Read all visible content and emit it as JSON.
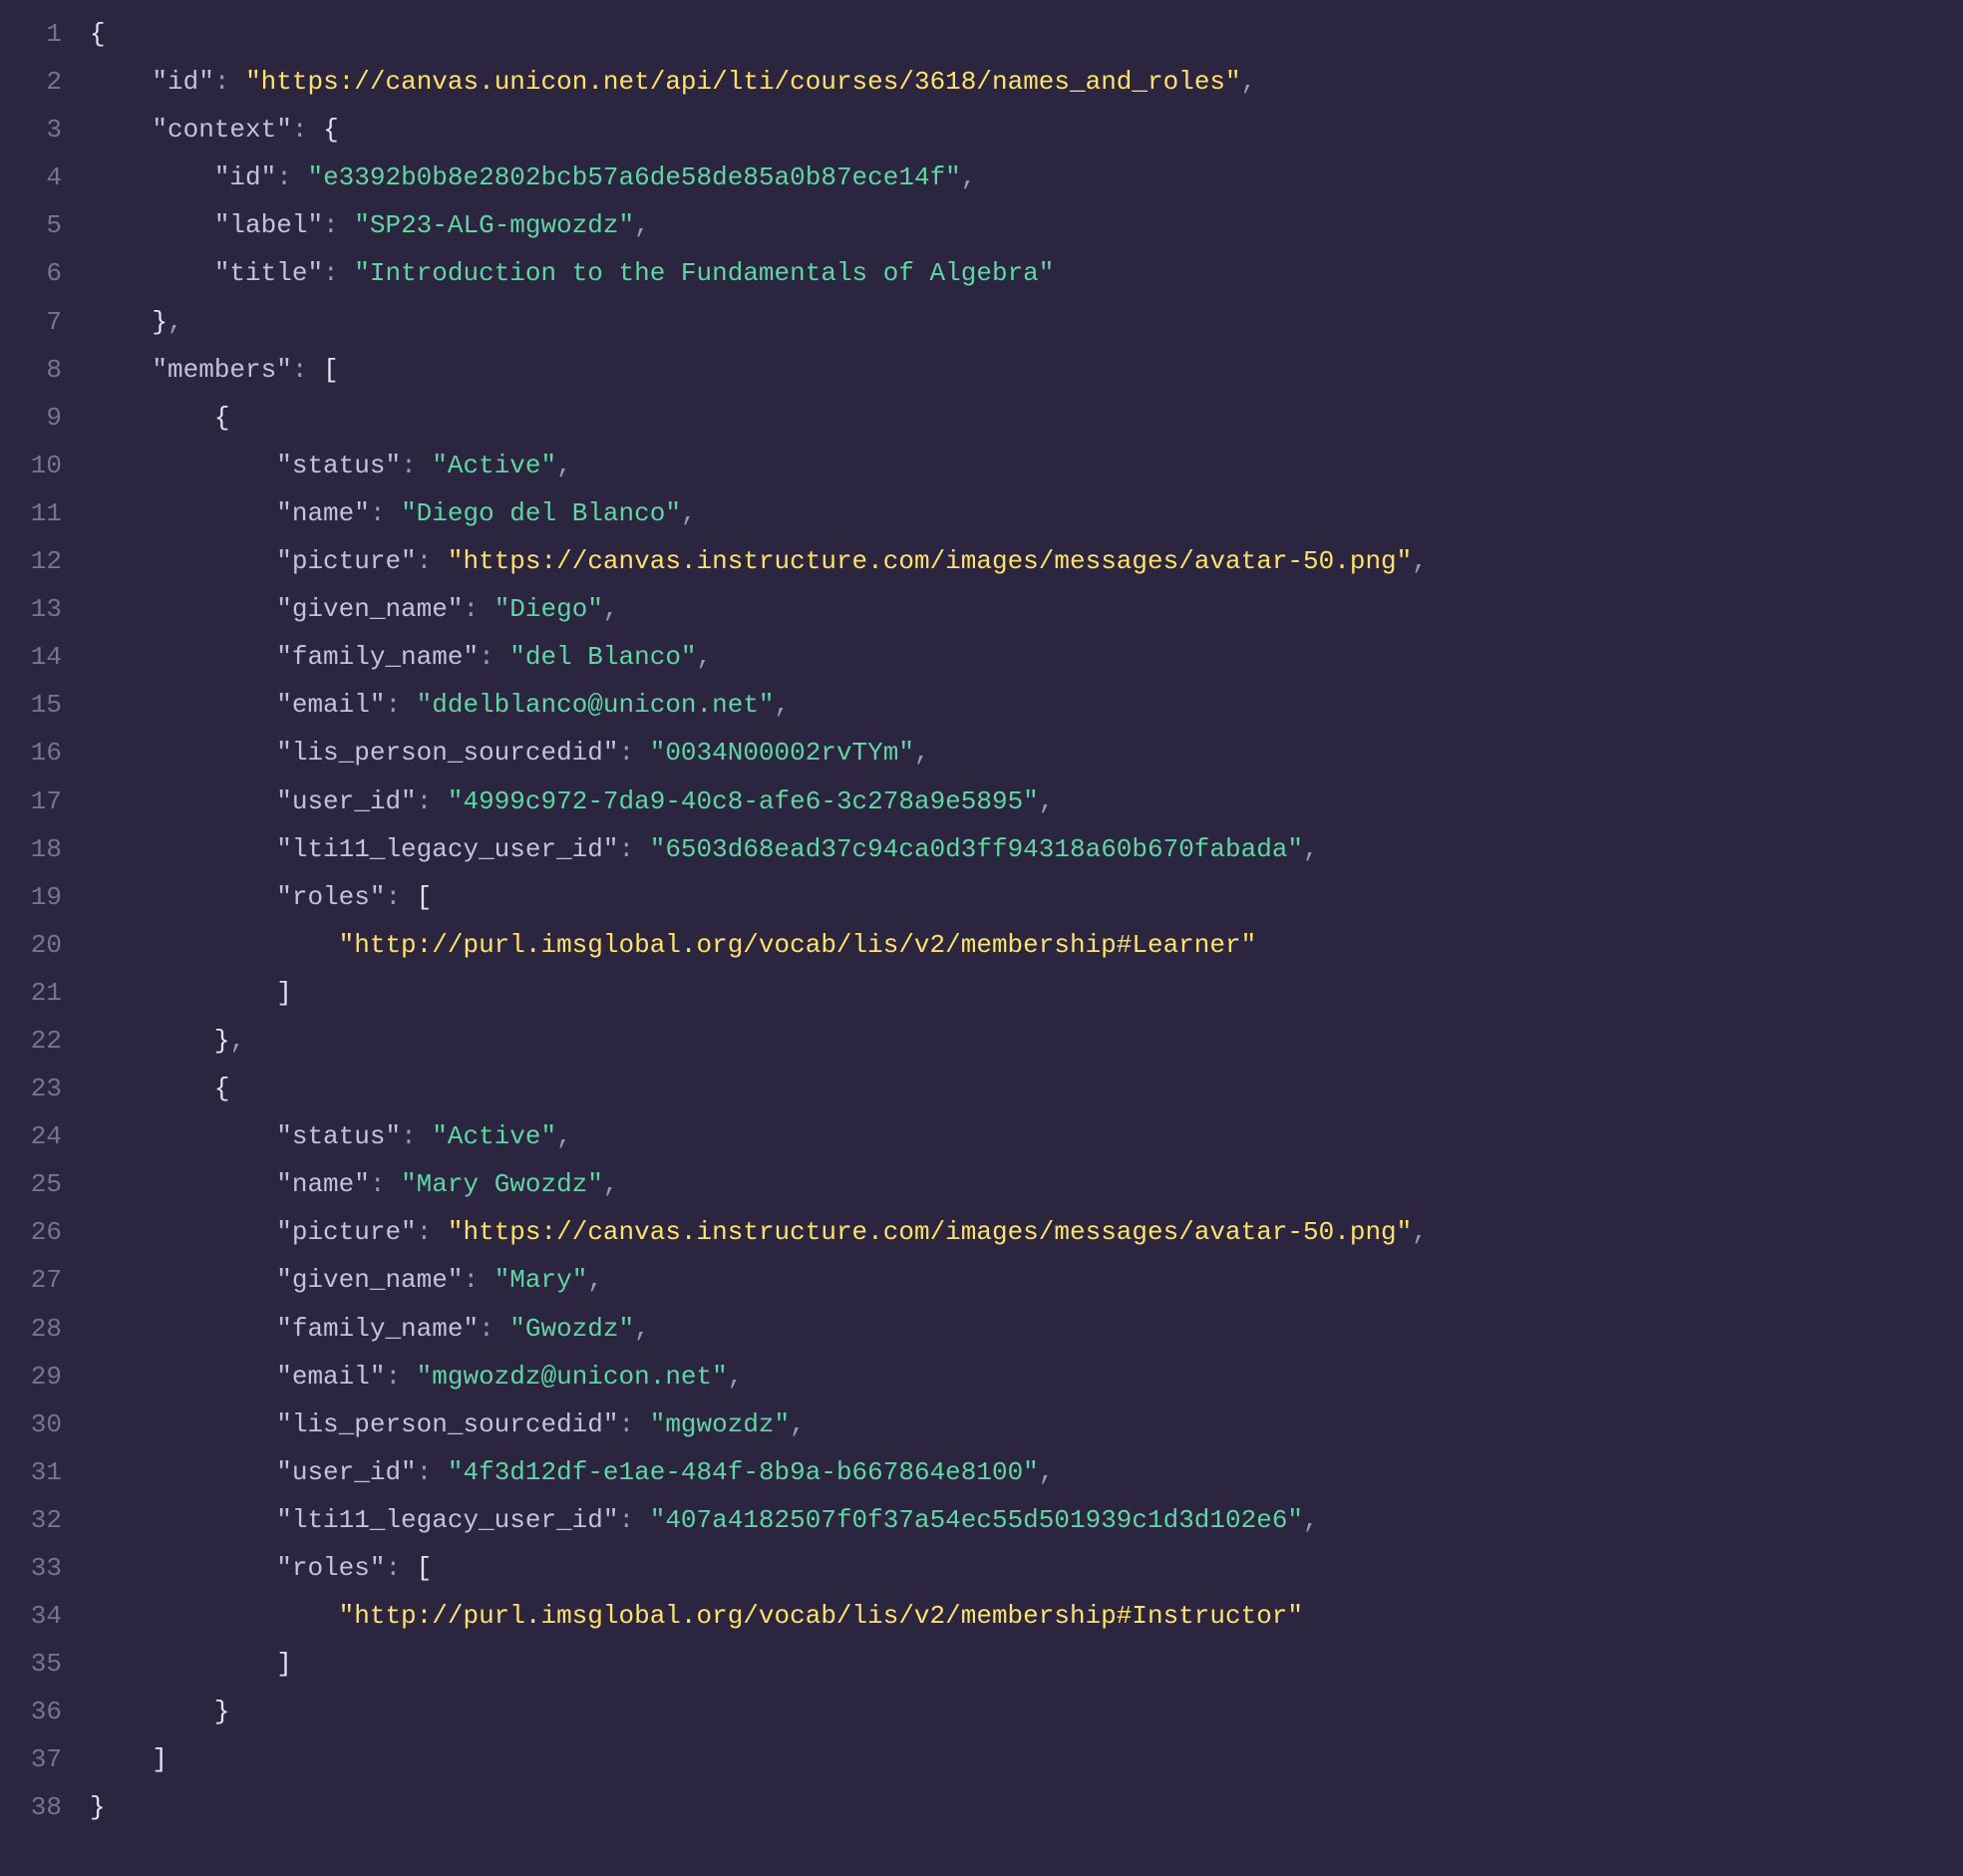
{
  "lines": [
    {
      "n": "1",
      "indent": 0,
      "tokens": [
        {
          "t": "{",
          "c": "brace"
        }
      ]
    },
    {
      "n": "2",
      "indent": 1,
      "tokens": [
        {
          "t": "\"id\"",
          "c": "key"
        },
        {
          "t": ": ",
          "c": "colon"
        },
        {
          "t": "\"https://canvas.unicon.net/api/lti/courses/3618/names_and_roles\"",
          "c": "url"
        },
        {
          "t": ",",
          "c": "comma"
        }
      ]
    },
    {
      "n": "3",
      "indent": 1,
      "tokens": [
        {
          "t": "\"context\"",
          "c": "key"
        },
        {
          "t": ": ",
          "c": "colon"
        },
        {
          "t": "{",
          "c": "brace"
        }
      ]
    },
    {
      "n": "4",
      "indent": 2,
      "tokens": [
        {
          "t": "\"id\"",
          "c": "key"
        },
        {
          "t": ": ",
          "c": "colon"
        },
        {
          "t": "\"e3392b0b8e2802bcb57a6de58de85a0b87ece14f\"",
          "c": "string"
        },
        {
          "t": ",",
          "c": "comma"
        }
      ]
    },
    {
      "n": "5",
      "indent": 2,
      "tokens": [
        {
          "t": "\"label\"",
          "c": "key"
        },
        {
          "t": ": ",
          "c": "colon"
        },
        {
          "t": "\"SP23-ALG-mgwozdz\"",
          "c": "string"
        },
        {
          "t": ",",
          "c": "comma"
        }
      ]
    },
    {
      "n": "6",
      "indent": 2,
      "tokens": [
        {
          "t": "\"title\"",
          "c": "key"
        },
        {
          "t": ": ",
          "c": "colon"
        },
        {
          "t": "\"Introduction to the Fundamentals of Algebra\"",
          "c": "string"
        }
      ]
    },
    {
      "n": "7",
      "indent": 1,
      "tokens": [
        {
          "t": "}",
          "c": "brace"
        },
        {
          "t": ",",
          "c": "comma"
        }
      ]
    },
    {
      "n": "8",
      "indent": 1,
      "tokens": [
        {
          "t": "\"members\"",
          "c": "key"
        },
        {
          "t": ": ",
          "c": "colon"
        },
        {
          "t": "[",
          "c": "brace"
        }
      ]
    },
    {
      "n": "9",
      "indent": 2,
      "tokens": [
        {
          "t": "{",
          "c": "brace"
        }
      ]
    },
    {
      "n": "10",
      "indent": 3,
      "tokens": [
        {
          "t": "\"status\"",
          "c": "key"
        },
        {
          "t": ": ",
          "c": "colon"
        },
        {
          "t": "\"Active\"",
          "c": "string"
        },
        {
          "t": ",",
          "c": "comma"
        }
      ]
    },
    {
      "n": "11",
      "indent": 3,
      "tokens": [
        {
          "t": "\"name\"",
          "c": "key"
        },
        {
          "t": ": ",
          "c": "colon"
        },
        {
          "t": "\"Diego del Blanco\"",
          "c": "string"
        },
        {
          "t": ",",
          "c": "comma"
        }
      ]
    },
    {
      "n": "12",
      "indent": 3,
      "tokens": [
        {
          "t": "\"picture\"",
          "c": "key"
        },
        {
          "t": ": ",
          "c": "colon"
        },
        {
          "t": "\"https://canvas.instructure.com/images/messages/avatar-50.png\"",
          "c": "url"
        },
        {
          "t": ",",
          "c": "comma"
        }
      ]
    },
    {
      "n": "13",
      "indent": 3,
      "tokens": [
        {
          "t": "\"given_name\"",
          "c": "key"
        },
        {
          "t": ": ",
          "c": "colon"
        },
        {
          "t": "\"Diego\"",
          "c": "string"
        },
        {
          "t": ",",
          "c": "comma"
        }
      ]
    },
    {
      "n": "14",
      "indent": 3,
      "tokens": [
        {
          "t": "\"family_name\"",
          "c": "key"
        },
        {
          "t": ": ",
          "c": "colon"
        },
        {
          "t": "\"del Blanco\"",
          "c": "string"
        },
        {
          "t": ",",
          "c": "comma"
        }
      ]
    },
    {
      "n": "15",
      "indent": 3,
      "tokens": [
        {
          "t": "\"email\"",
          "c": "key"
        },
        {
          "t": ": ",
          "c": "colon"
        },
        {
          "t": "\"ddelblanco@unicon.net\"",
          "c": "string"
        },
        {
          "t": ",",
          "c": "comma"
        }
      ]
    },
    {
      "n": "16",
      "indent": 3,
      "tokens": [
        {
          "t": "\"lis_person_sourcedid\"",
          "c": "key"
        },
        {
          "t": ": ",
          "c": "colon"
        },
        {
          "t": "\"0034N00002rvTYm\"",
          "c": "string"
        },
        {
          "t": ",",
          "c": "comma"
        }
      ]
    },
    {
      "n": "17",
      "indent": 3,
      "tokens": [
        {
          "t": "\"user_id\"",
          "c": "key"
        },
        {
          "t": ": ",
          "c": "colon"
        },
        {
          "t": "\"4999c972-7da9-40c8-afe6-3c278a9e5895\"",
          "c": "string"
        },
        {
          "t": ",",
          "c": "comma"
        }
      ]
    },
    {
      "n": "18",
      "indent": 3,
      "tokens": [
        {
          "t": "\"lti11_legacy_user_id\"",
          "c": "key"
        },
        {
          "t": ": ",
          "c": "colon"
        },
        {
          "t": "\"6503d68ead37c94ca0d3ff94318a60b670fabada\"",
          "c": "string"
        },
        {
          "t": ",",
          "c": "comma"
        }
      ]
    },
    {
      "n": "19",
      "indent": 3,
      "tokens": [
        {
          "t": "\"roles\"",
          "c": "key"
        },
        {
          "t": ": ",
          "c": "colon"
        },
        {
          "t": "[",
          "c": "brace"
        }
      ]
    },
    {
      "n": "20",
      "indent": 4,
      "tokens": [
        {
          "t": "\"http://purl.imsglobal.org/vocab/lis/v2/membership#Learner\"",
          "c": "url"
        }
      ]
    },
    {
      "n": "21",
      "indent": 3,
      "tokens": [
        {
          "t": "]",
          "c": "brace"
        }
      ]
    },
    {
      "n": "22",
      "indent": 2,
      "tokens": [
        {
          "t": "}",
          "c": "brace"
        },
        {
          "t": ",",
          "c": "comma"
        }
      ]
    },
    {
      "n": "23",
      "indent": 2,
      "tokens": [
        {
          "t": "{",
          "c": "brace"
        }
      ]
    },
    {
      "n": "24",
      "indent": 3,
      "tokens": [
        {
          "t": "\"status\"",
          "c": "key"
        },
        {
          "t": ": ",
          "c": "colon"
        },
        {
          "t": "\"Active\"",
          "c": "string"
        },
        {
          "t": ",",
          "c": "comma"
        }
      ]
    },
    {
      "n": "25",
      "indent": 3,
      "tokens": [
        {
          "t": "\"name\"",
          "c": "key"
        },
        {
          "t": ": ",
          "c": "colon"
        },
        {
          "t": "\"Mary Gwozdz\"",
          "c": "string"
        },
        {
          "t": ",",
          "c": "comma"
        }
      ]
    },
    {
      "n": "26",
      "indent": 3,
      "tokens": [
        {
          "t": "\"picture\"",
          "c": "key"
        },
        {
          "t": ": ",
          "c": "colon"
        },
        {
          "t": "\"https://canvas.instructure.com/images/messages/avatar-50.png\"",
          "c": "url"
        },
        {
          "t": ",",
          "c": "comma"
        }
      ]
    },
    {
      "n": "27",
      "indent": 3,
      "tokens": [
        {
          "t": "\"given_name\"",
          "c": "key"
        },
        {
          "t": ": ",
          "c": "colon"
        },
        {
          "t": "\"Mary\"",
          "c": "string"
        },
        {
          "t": ",",
          "c": "comma"
        }
      ]
    },
    {
      "n": "28",
      "indent": 3,
      "tokens": [
        {
          "t": "\"family_name\"",
          "c": "key"
        },
        {
          "t": ": ",
          "c": "colon"
        },
        {
          "t": "\"Gwozdz\"",
          "c": "string"
        },
        {
          "t": ",",
          "c": "comma"
        }
      ]
    },
    {
      "n": "29",
      "indent": 3,
      "tokens": [
        {
          "t": "\"email\"",
          "c": "key"
        },
        {
          "t": ": ",
          "c": "colon"
        },
        {
          "t": "\"mgwozdz@unicon.net\"",
          "c": "string"
        },
        {
          "t": ",",
          "c": "comma"
        }
      ]
    },
    {
      "n": "30",
      "indent": 3,
      "tokens": [
        {
          "t": "\"lis_person_sourcedid\"",
          "c": "key"
        },
        {
          "t": ": ",
          "c": "colon"
        },
        {
          "t": "\"mgwozdz\"",
          "c": "string"
        },
        {
          "t": ",",
          "c": "comma"
        }
      ]
    },
    {
      "n": "31",
      "indent": 3,
      "tokens": [
        {
          "t": "\"user_id\"",
          "c": "key"
        },
        {
          "t": ": ",
          "c": "colon"
        },
        {
          "t": "\"4f3d12df-e1ae-484f-8b9a-b667864e8100\"",
          "c": "string"
        },
        {
          "t": ",",
          "c": "comma"
        }
      ]
    },
    {
      "n": "32",
      "indent": 3,
      "tokens": [
        {
          "t": "\"lti11_legacy_user_id\"",
          "c": "key"
        },
        {
          "t": ": ",
          "c": "colon"
        },
        {
          "t": "\"407a4182507f0f37a54ec55d501939c1d3d102e6\"",
          "c": "string"
        },
        {
          "t": ",",
          "c": "comma"
        }
      ]
    },
    {
      "n": "33",
      "indent": 3,
      "tokens": [
        {
          "t": "\"roles\"",
          "c": "key"
        },
        {
          "t": ": ",
          "c": "colon"
        },
        {
          "t": "[",
          "c": "brace"
        }
      ]
    },
    {
      "n": "34",
      "indent": 4,
      "tokens": [
        {
          "t": "\"http://purl.imsglobal.org/vocab/lis/v2/membership#Instructor\"",
          "c": "url"
        }
      ]
    },
    {
      "n": "35",
      "indent": 3,
      "tokens": [
        {
          "t": "]",
          "c": "brace"
        }
      ]
    },
    {
      "n": "36",
      "indent": 2,
      "tokens": [
        {
          "t": "}",
          "c": "brace"
        }
      ]
    },
    {
      "n": "37",
      "indent": 1,
      "tokens": [
        {
          "t": "]",
          "c": "brace"
        }
      ]
    },
    {
      "n": "38",
      "indent": 0,
      "tokens": [
        {
          "t": "}",
          "c": "brace"
        }
      ]
    }
  ],
  "indentUnit": "    "
}
